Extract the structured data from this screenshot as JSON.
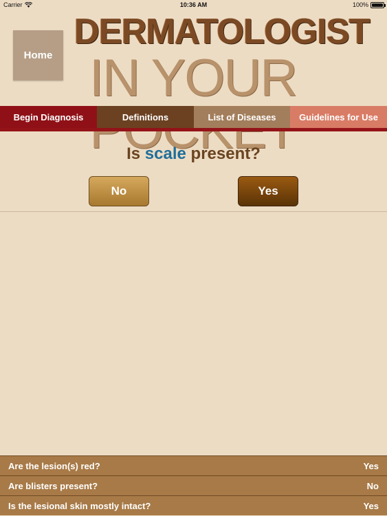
{
  "status_bar": {
    "carrier": "Carrier",
    "time": "10:36 AM",
    "battery": "100%"
  },
  "header": {
    "home_label": "Home",
    "logo_line1": "DERMATOLOGIST",
    "logo_line2": "IN YOUR POCKET"
  },
  "nav": {
    "tabs": [
      {
        "label": "Begin Diagnosis",
        "color": "#8f1117"
      },
      {
        "label": "Definitions",
        "color": "#6b4122"
      },
      {
        "label": "List of Diseases",
        "color": "#a37e5c"
      },
      {
        "label": "Guidelines for Use",
        "color": "#d97c66"
      }
    ]
  },
  "question": {
    "prefix": "Is ",
    "keyword": "scale",
    "suffix": " present?"
  },
  "answers": {
    "no_label": "No",
    "yes_label": "Yes"
  },
  "history": [
    {
      "question": "Are the lesion(s) red?",
      "answer": "Yes"
    },
    {
      "question": "Are blisters present?",
      "answer": "No"
    },
    {
      "question": "Is the lesional skin mostly intact?",
      "answer": "Yes"
    }
  ]
}
